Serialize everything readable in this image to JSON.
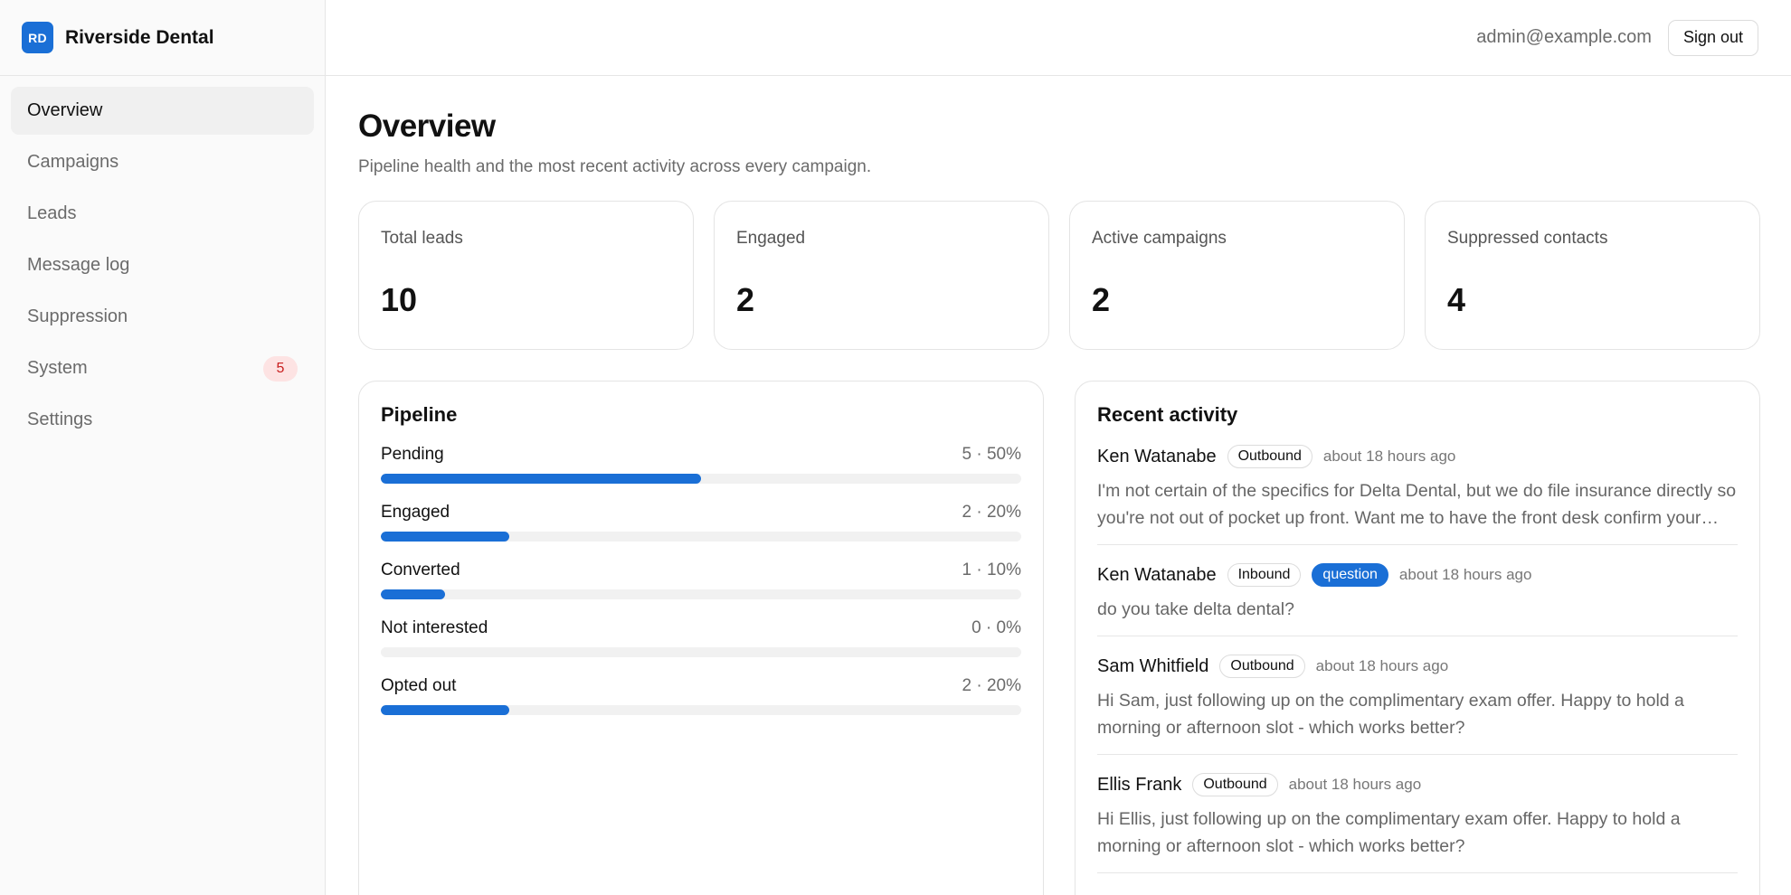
{
  "brand": {
    "logo": "RD",
    "name": "Riverside Dental"
  },
  "nav": [
    {
      "label": "Overview",
      "active": true
    },
    {
      "label": "Campaigns"
    },
    {
      "label": "Leads"
    },
    {
      "label": "Message log"
    },
    {
      "label": "Suppression"
    },
    {
      "label": "System",
      "badge": "5"
    },
    {
      "label": "Settings"
    }
  ],
  "topbar": {
    "email": "admin@example.com",
    "signout": "Sign out"
  },
  "page": {
    "title": "Overview",
    "subtitle": "Pipeline health and the most recent activity across every campaign."
  },
  "stats": [
    {
      "label": "Total leads",
      "value": "10"
    },
    {
      "label": "Engaged",
      "value": "2"
    },
    {
      "label": "Active campaigns",
      "value": "2"
    },
    {
      "label": "Suppressed contacts",
      "value": "4"
    }
  ],
  "pipeline": {
    "title": "Pipeline",
    "rows": [
      {
        "label": "Pending",
        "value": "5 · 50%",
        "fraction": 0.5
      },
      {
        "label": "Engaged",
        "value": "2 · 20%",
        "fraction": 0.2
      },
      {
        "label": "Converted",
        "value": "1 · 10%",
        "fraction": 0.1
      },
      {
        "label": "Not interested",
        "value": "0 · 0%",
        "fraction": 0.0
      },
      {
        "label": "Opted out",
        "value": "2 · 20%",
        "fraction": 0.2
      }
    ]
  },
  "activity": {
    "title": "Recent activity",
    "items": [
      {
        "name": "Ken Watanabe",
        "tags": [
          {
            "label": "Outbound"
          }
        ],
        "time": "about 18 hours ago",
        "message": "I'm not certain of the specifics for Delta Dental, but we do file insurance directly so you're not out of pocket up front. Want me to have the front desk confirm your coverage?"
      },
      {
        "name": "Ken Watanabe",
        "tags": [
          {
            "label": "Inbound"
          },
          {
            "label": "question",
            "accent": true
          }
        ],
        "time": "about 18 hours ago",
        "message": "do you take delta dental?"
      },
      {
        "name": "Sam Whitfield",
        "tags": [
          {
            "label": "Outbound"
          }
        ],
        "time": "about 18 hours ago",
        "message": "Hi Sam, just following up on the complimentary exam offer. Happy to hold a morning or afternoon slot - which works better?"
      },
      {
        "name": "Ellis Frank",
        "tags": [
          {
            "label": "Outbound"
          }
        ],
        "time": "about 18 hours ago",
        "message": "Hi Ellis, just following up on the complimentary exam offer. Happy to hold a morning or afternoon slot - which works better?"
      }
    ]
  },
  "colors": {
    "accent": "#1a6fd6",
    "badge_bg": "#fde3e3",
    "badge_text": "#c81e1e"
  }
}
